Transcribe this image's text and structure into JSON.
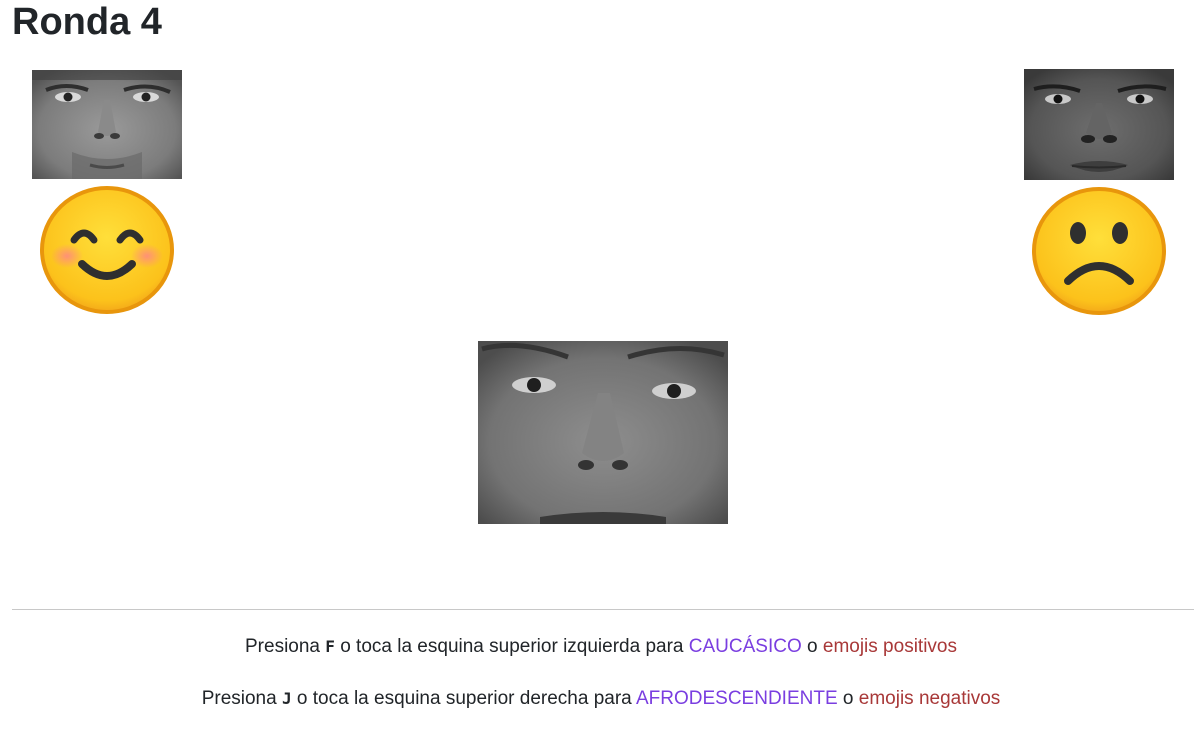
{
  "header": {
    "title": "Ronda 4"
  },
  "stimuli": {
    "left_category_image": "caucasian-face-photo",
    "right_category_image": "afro-descendant-face-photo",
    "center_target_image": "caucasian-face-photo",
    "left_attribute_icon": "smiling-emoji-icon",
    "right_attribute_icon": "frowning-emoji-icon"
  },
  "instructions": {
    "line1": {
      "prefix": "Presiona",
      "key": "F",
      "middle": "o toca la esquina superior izquierda para",
      "category": "CAUCÁSICO",
      "connector": "o",
      "attribute": "emojis positivos"
    },
    "line2": {
      "prefix": "Presiona",
      "key": "J",
      "middle": "o toca la esquina superior derecha para",
      "category": "AFRODESCENDIENTE",
      "connector": "o",
      "attribute": "emojis negativos"
    }
  },
  "colors": {
    "category_text": "#7a3ee0",
    "attribute_text": "#a83838",
    "emoji_fill": "#fcc21b",
    "emoji_outline": "#e8960c"
  }
}
